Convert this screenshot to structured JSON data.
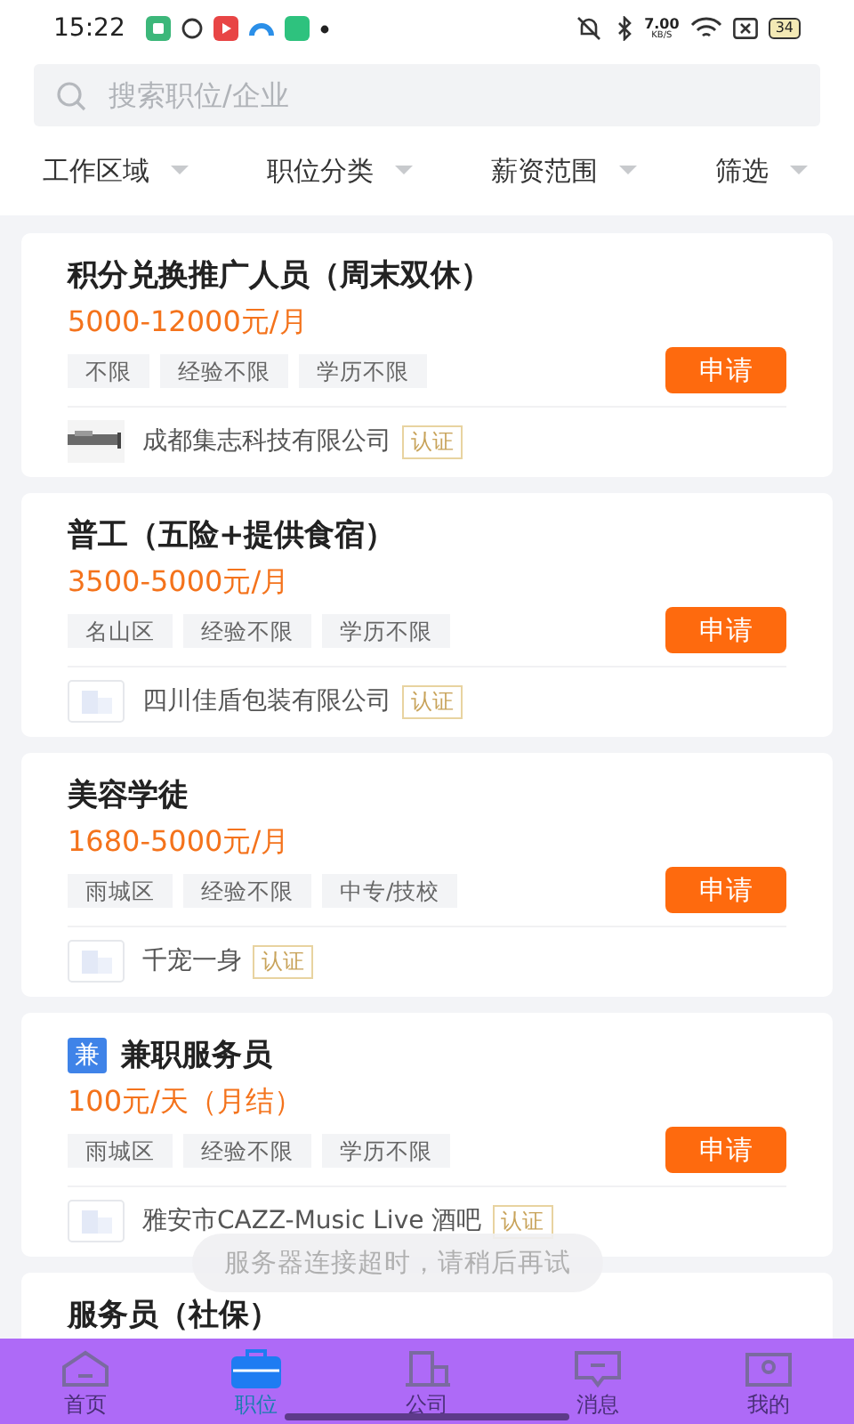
{
  "status_bar": {
    "time": "15:22",
    "speed_value": "7.00",
    "speed_unit": "KB/S",
    "battery": "34"
  },
  "search": {
    "placeholder": "搜索职位/企业"
  },
  "filters": [
    {
      "label": "工作区域"
    },
    {
      "label": "职位分类"
    },
    {
      "label": "薪资范围"
    },
    {
      "label": "筛选"
    }
  ],
  "jobs": [
    {
      "title": "积分兑换推广人员（周末双休）",
      "salary": "5000-12000元/月",
      "tags": [
        "不限",
        "经验不限",
        "学历不限"
      ],
      "button": "申请",
      "company": "成都集志科技有限公司",
      "logo": {
        "kind": "picture"
      },
      "verified": "认证"
    },
    {
      "title": "普工（五险+提供食宿）",
      "salary": "3500-5000元/月",
      "tags": [
        "名山区",
        "经验不限",
        "学历不限"
      ],
      "button": "申请",
      "company": "四川佳盾包装有限公司",
      "logo": {
        "kind": "placeholder"
      },
      "verified": "认证"
    },
    {
      "title": "美容学徒",
      "salary": "1680-5000元/月",
      "tags": [
        "雨城区",
        "经验不限",
        "中专/技校"
      ],
      "button": "申请",
      "company": "千宠一身",
      "logo": {
        "kind": "placeholder"
      },
      "verified": "认证"
    },
    {
      "badge": "兼",
      "title": "兼职服务员",
      "salary": "100元/天（月结）",
      "tags": [
        "雨城区",
        "经验不限",
        "学历不限"
      ],
      "button": "申请",
      "company": "雅安市CAZZ-Music Live 酒吧",
      "logo": {
        "kind": "placeholder"
      },
      "verified": "认证"
    },
    {
      "title": "服务员（社保）"
    }
  ],
  "toast": "服务器连接超时，请稍后再试",
  "tab_bar": [
    {
      "label": "首页",
      "selected": false
    },
    {
      "label": "职位",
      "selected": true
    },
    {
      "label": "公司",
      "selected": false
    },
    {
      "label": "消息",
      "selected": false
    },
    {
      "label": "我的",
      "selected": false
    }
  ]
}
